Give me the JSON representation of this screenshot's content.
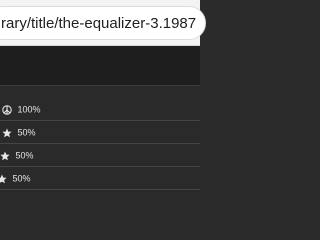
{
  "address_bar": {
    "url": "rary/title/the-equalizer-3.1987"
  },
  "ratings": [
    {
      "icon": "peace-icon",
      "value": "100%"
    },
    {
      "icon": "star-icon",
      "value": "50%"
    },
    {
      "icon": "star-icon",
      "value": "50%"
    },
    {
      "icon": "star-icon",
      "value": "50%"
    }
  ]
}
